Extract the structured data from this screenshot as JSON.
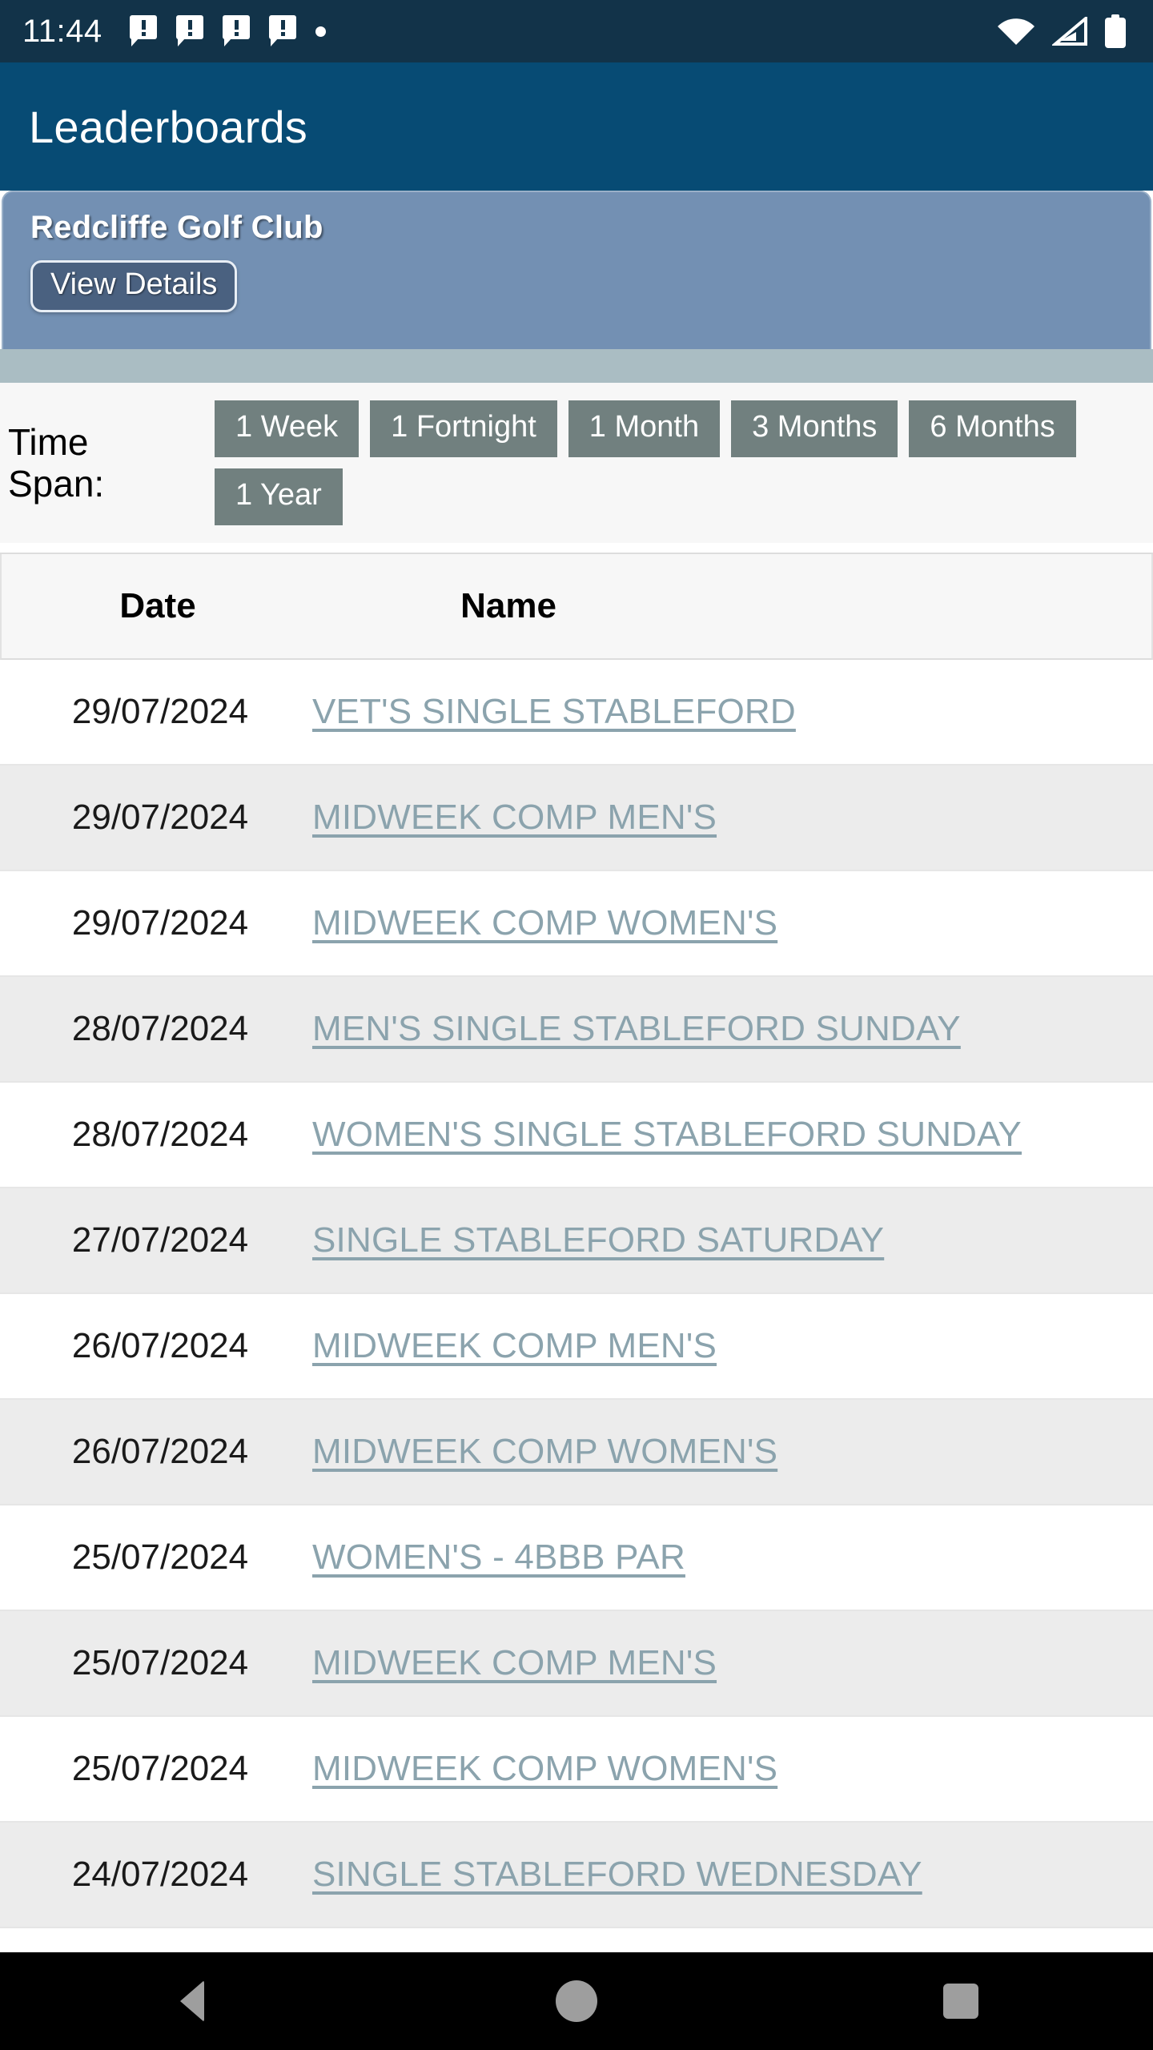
{
  "status_bar": {
    "time": "11:44",
    "left_icons": [
      "message-alert-icon",
      "message-alert-icon",
      "message-alert-icon",
      "message-alert-icon",
      "dot-icon"
    ],
    "right_icons": [
      "wifi-icon",
      "cellular-signal-icon",
      "battery-icon"
    ]
  },
  "app_bar": {
    "title": "Leaderboards",
    "color": "#074b74"
  },
  "club_panel": {
    "name": "Redcliffe Golf Club",
    "view_details_label": "View Details",
    "color": "#7390b3"
  },
  "time_span": {
    "label_line1": "Time",
    "label_line2": "Span:",
    "buttons": [
      "1 Week",
      "1 Fortnight",
      "1 Month",
      "3 Months",
      "6 Months",
      "1 Year"
    ],
    "button_color": "#71807f"
  },
  "table": {
    "columns": [
      "Date",
      "Name"
    ],
    "link_color": "#8ba3ad",
    "rows": [
      {
        "date": "29/07/2024",
        "name": "VET'S SINGLE STABLEFORD"
      },
      {
        "date": "29/07/2024",
        "name": "MIDWEEK COMP MEN'S"
      },
      {
        "date": "29/07/2024",
        "name": "MIDWEEK COMP WOMEN'S"
      },
      {
        "date": "28/07/2024",
        "name": "MEN'S SINGLE STABLEFORD SUNDAY"
      },
      {
        "date": "28/07/2024",
        "name": "WOMEN'S SINGLE STABLEFORD SUNDAY"
      },
      {
        "date": "27/07/2024",
        "name": "SINGLE STABLEFORD SATURDAY"
      },
      {
        "date": "26/07/2024",
        "name": "MIDWEEK COMP MEN'S"
      },
      {
        "date": "26/07/2024",
        "name": "MIDWEEK COMP WOMEN'S"
      },
      {
        "date": "25/07/2024",
        "name": "WOMEN'S - 4BBB PAR"
      },
      {
        "date": "25/07/2024",
        "name": "MIDWEEK COMP MEN'S"
      },
      {
        "date": "25/07/2024",
        "name": "MIDWEEK COMP WOMEN'S"
      },
      {
        "date": "24/07/2024",
        "name": "SINGLE STABLEFORD WEDNESDAY"
      }
    ]
  },
  "nav_bar": {
    "items": [
      "back-icon",
      "home-icon",
      "recents-icon"
    ]
  }
}
